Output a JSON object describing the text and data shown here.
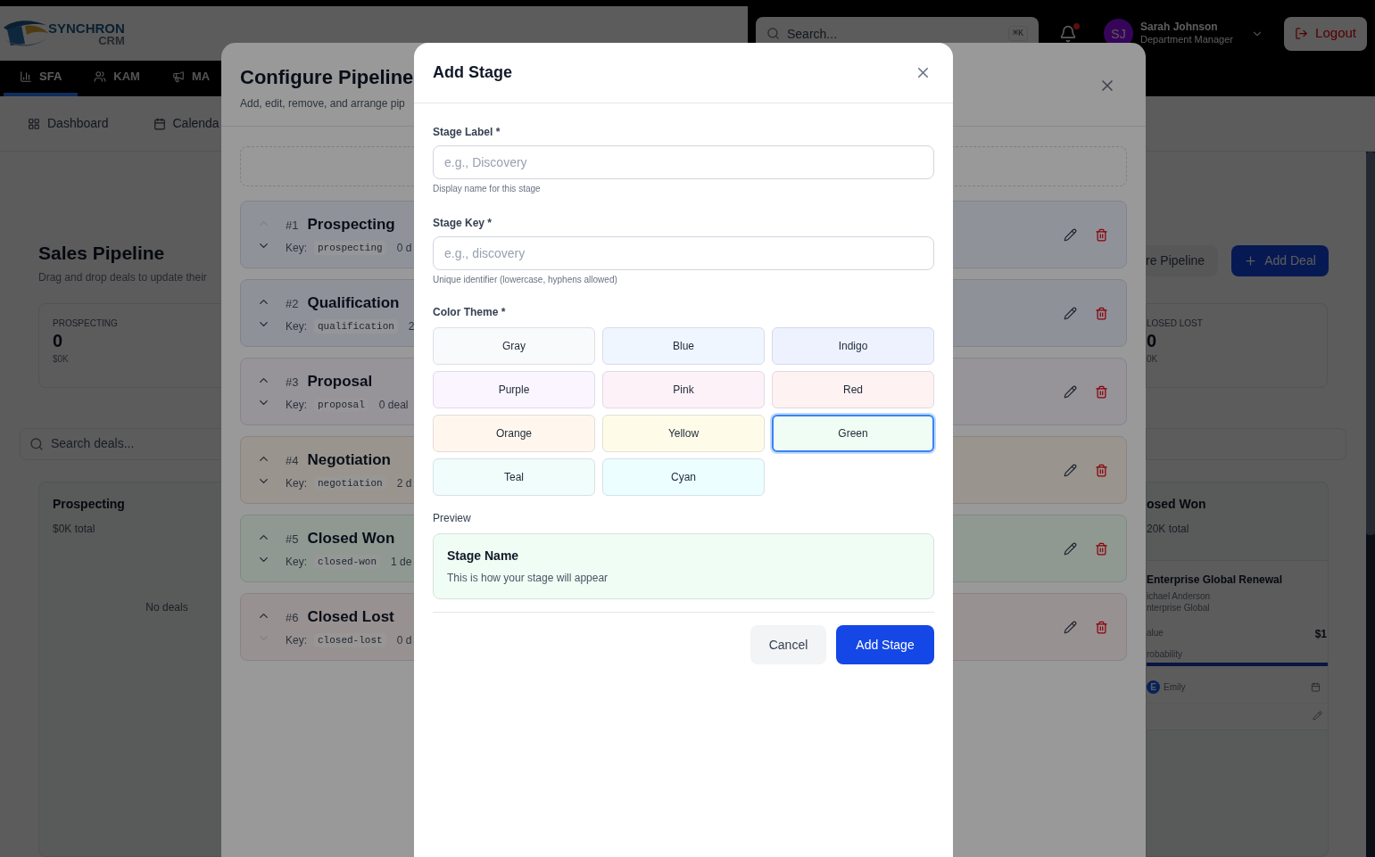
{
  "header": {
    "logo": {
      "name": "SYNCHRON",
      "sub": "CRM"
    },
    "search": {
      "placeholder": "Search...",
      "shortcut": "⌘K"
    },
    "notifications": {
      "unread": true
    },
    "user": {
      "initials": "SJ",
      "name": "Sarah Johnson",
      "role": "Department Manager"
    },
    "logout": "Logout"
  },
  "nav": [
    {
      "label": "SFA",
      "selected": true
    },
    {
      "label": "KAM",
      "selected": false
    },
    {
      "label": "MA",
      "selected": false
    }
  ],
  "subnav": [
    {
      "label": "Dashboard"
    },
    {
      "label": "Calenda"
    }
  ],
  "page": {
    "title": "Sales Pipeline",
    "subtitle": "Drag and drop deals to update their",
    "configure_button": "re Pipeline",
    "add_button": "Add Deal",
    "stats": [
      {
        "label": "PROSPECTING",
        "count": "0",
        "value": "$0K"
      },
      {
        "label": "LOSED LOST",
        "count": "0",
        "value": "0K"
      }
    ],
    "search": {
      "placeholder": "Search deals..."
    },
    "columns": [
      {
        "title": "Prospecting",
        "total": "$0K total",
        "empty": "No deals"
      },
      {
        "title": "osed Won",
        "total": "20K total",
        "deals": [
          {
            "title": "Enterprise Global Renewal",
            "contact": "ichael Anderson",
            "company": "nterprise Global",
            "value_label": "alue",
            "value": "$1",
            "probability_label": "robability",
            "level": 1,
            "owner_initial": "E",
            "owner": "Emily"
          }
        ]
      }
    ]
  },
  "configure": {
    "title": "Configure Pipeline",
    "subtitle": "Add, edit, remove, and arrange pip",
    "stages": [
      {
        "number": "#1",
        "name": "Prospecting",
        "key_label": "Key:",
        "key": "prospecting",
        "deals": "0 d",
        "color": "#eff6ff",
        "can_move_up": false,
        "can_move_down": true
      },
      {
        "number": "#2",
        "name": "Qualification",
        "key_label": "Key:",
        "key": "qualification",
        "deals": "2",
        "color": "#eef2ff",
        "can_move_up": true,
        "can_move_down": true
      },
      {
        "number": "#3",
        "name": "Proposal",
        "key_label": "Key:",
        "key": "proposal",
        "deals": "0 deal",
        "color": "#faf5ff",
        "can_move_up": true,
        "can_move_down": true
      },
      {
        "number": "#4",
        "name": "Negotiation",
        "key_label": "Key:",
        "key": "negotiation",
        "deals": "2 d",
        "color": "#fff7ed",
        "can_move_up": true,
        "can_move_down": true
      },
      {
        "number": "#5",
        "name": "Closed Won",
        "key_label": "Key:",
        "key": "closed-won",
        "deals": "1 de",
        "color": "#f0fdf4",
        "can_move_up": true,
        "can_move_down": true
      },
      {
        "number": "#6",
        "name": "Closed Lost",
        "key_label": "Key:",
        "key": "closed-lost",
        "deals": "0 d",
        "color": "#fef2f2",
        "can_move_up": true,
        "can_move_down": false
      }
    ]
  },
  "add_stage": {
    "title": "Add Stage",
    "fields": [
      {
        "label": "Stage Label *",
        "placeholder": "e.g., Discovery",
        "hint": "Display name for this stage"
      },
      {
        "label": "Stage Key *",
        "placeholder": "e.g., discovery",
        "hint": "Unique identifier (lowercase, hyphens allowed)"
      }
    ],
    "color_label": "Color Theme *",
    "themes": [
      {
        "label": "Gray",
        "color": "#f9fafb",
        "selected": false
      },
      {
        "label": "Blue",
        "color": "#eff6ff",
        "selected": false
      },
      {
        "label": "Indigo",
        "color": "#eef2ff",
        "selected": false
      },
      {
        "label": "Purple",
        "color": "#faf5ff",
        "selected": false
      },
      {
        "label": "Pink",
        "color": "#fdf2f8",
        "selected": false
      },
      {
        "label": "Red",
        "color": "#fef2f2",
        "selected": false
      },
      {
        "label": "Orange",
        "color": "#fff7ed",
        "selected": false
      },
      {
        "label": "Yellow",
        "color": "#fefce8",
        "selected": false
      },
      {
        "label": "Green",
        "color": "#f0fdf4",
        "selected": true
      },
      {
        "label": "Teal",
        "color": "#f0fdfa",
        "selected": false
      },
      {
        "label": "Cyan",
        "color": "#ecfeff",
        "selected": false
      }
    ],
    "preview_label": "Preview",
    "preview": {
      "title": "Stage Name",
      "text": "This is how your stage will appear"
    },
    "buttons": {
      "cancel": "Cancel",
      "submit": "Add Stage"
    }
  }
}
